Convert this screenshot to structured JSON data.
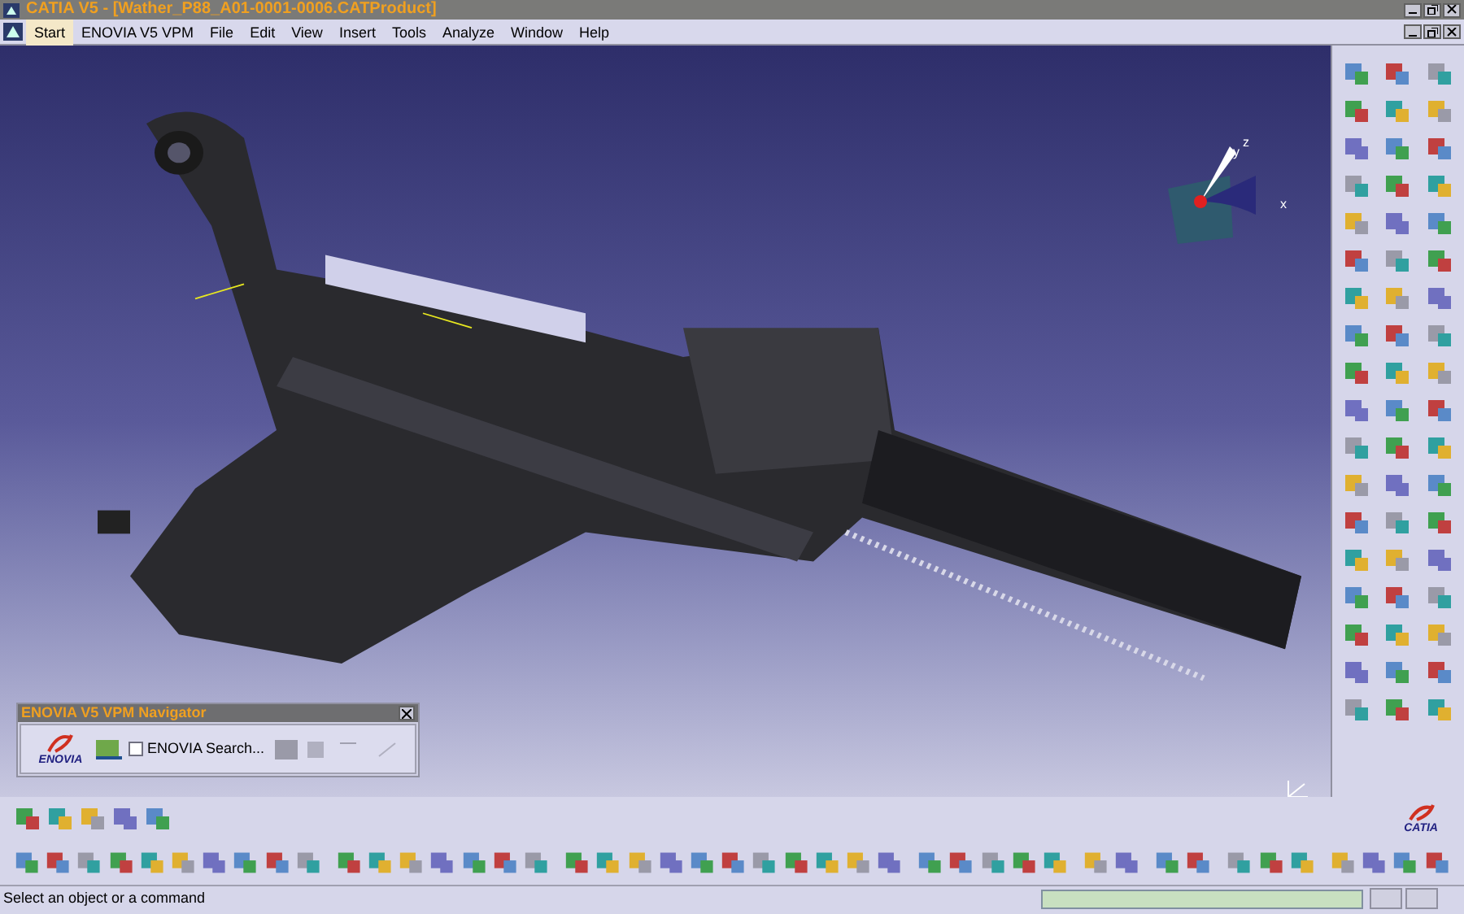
{
  "window": {
    "title": "CATIA V5 - [Wather_P88_A01-0001-0006.CATProduct]"
  },
  "menu": [
    {
      "label": "Start",
      "selected": true
    },
    {
      "label": "ENOVIA V5 VPM",
      "selected": false
    },
    {
      "label": "File",
      "selected": false
    },
    {
      "label": "Edit",
      "selected": false
    },
    {
      "label": "View",
      "selected": false
    },
    {
      "label": "Insert",
      "selected": false
    },
    {
      "label": "Tools",
      "selected": false
    },
    {
      "label": "Analyze",
      "selected": false
    },
    {
      "label": "Window",
      "selected": false
    },
    {
      "label": "Help",
      "selected": false
    }
  ],
  "compass": {
    "axis_x": "x",
    "axis_y": "y",
    "axis_z": "z"
  },
  "navigator": {
    "title": "ENOVIA V5 VPM Navigator",
    "logo": "ENOVIA",
    "search_label": "ENOVIA Search...",
    "search_checked": false
  },
  "brand_logo": "CATIA",
  "status_bar": {
    "message": "Select an object or a command"
  }
}
